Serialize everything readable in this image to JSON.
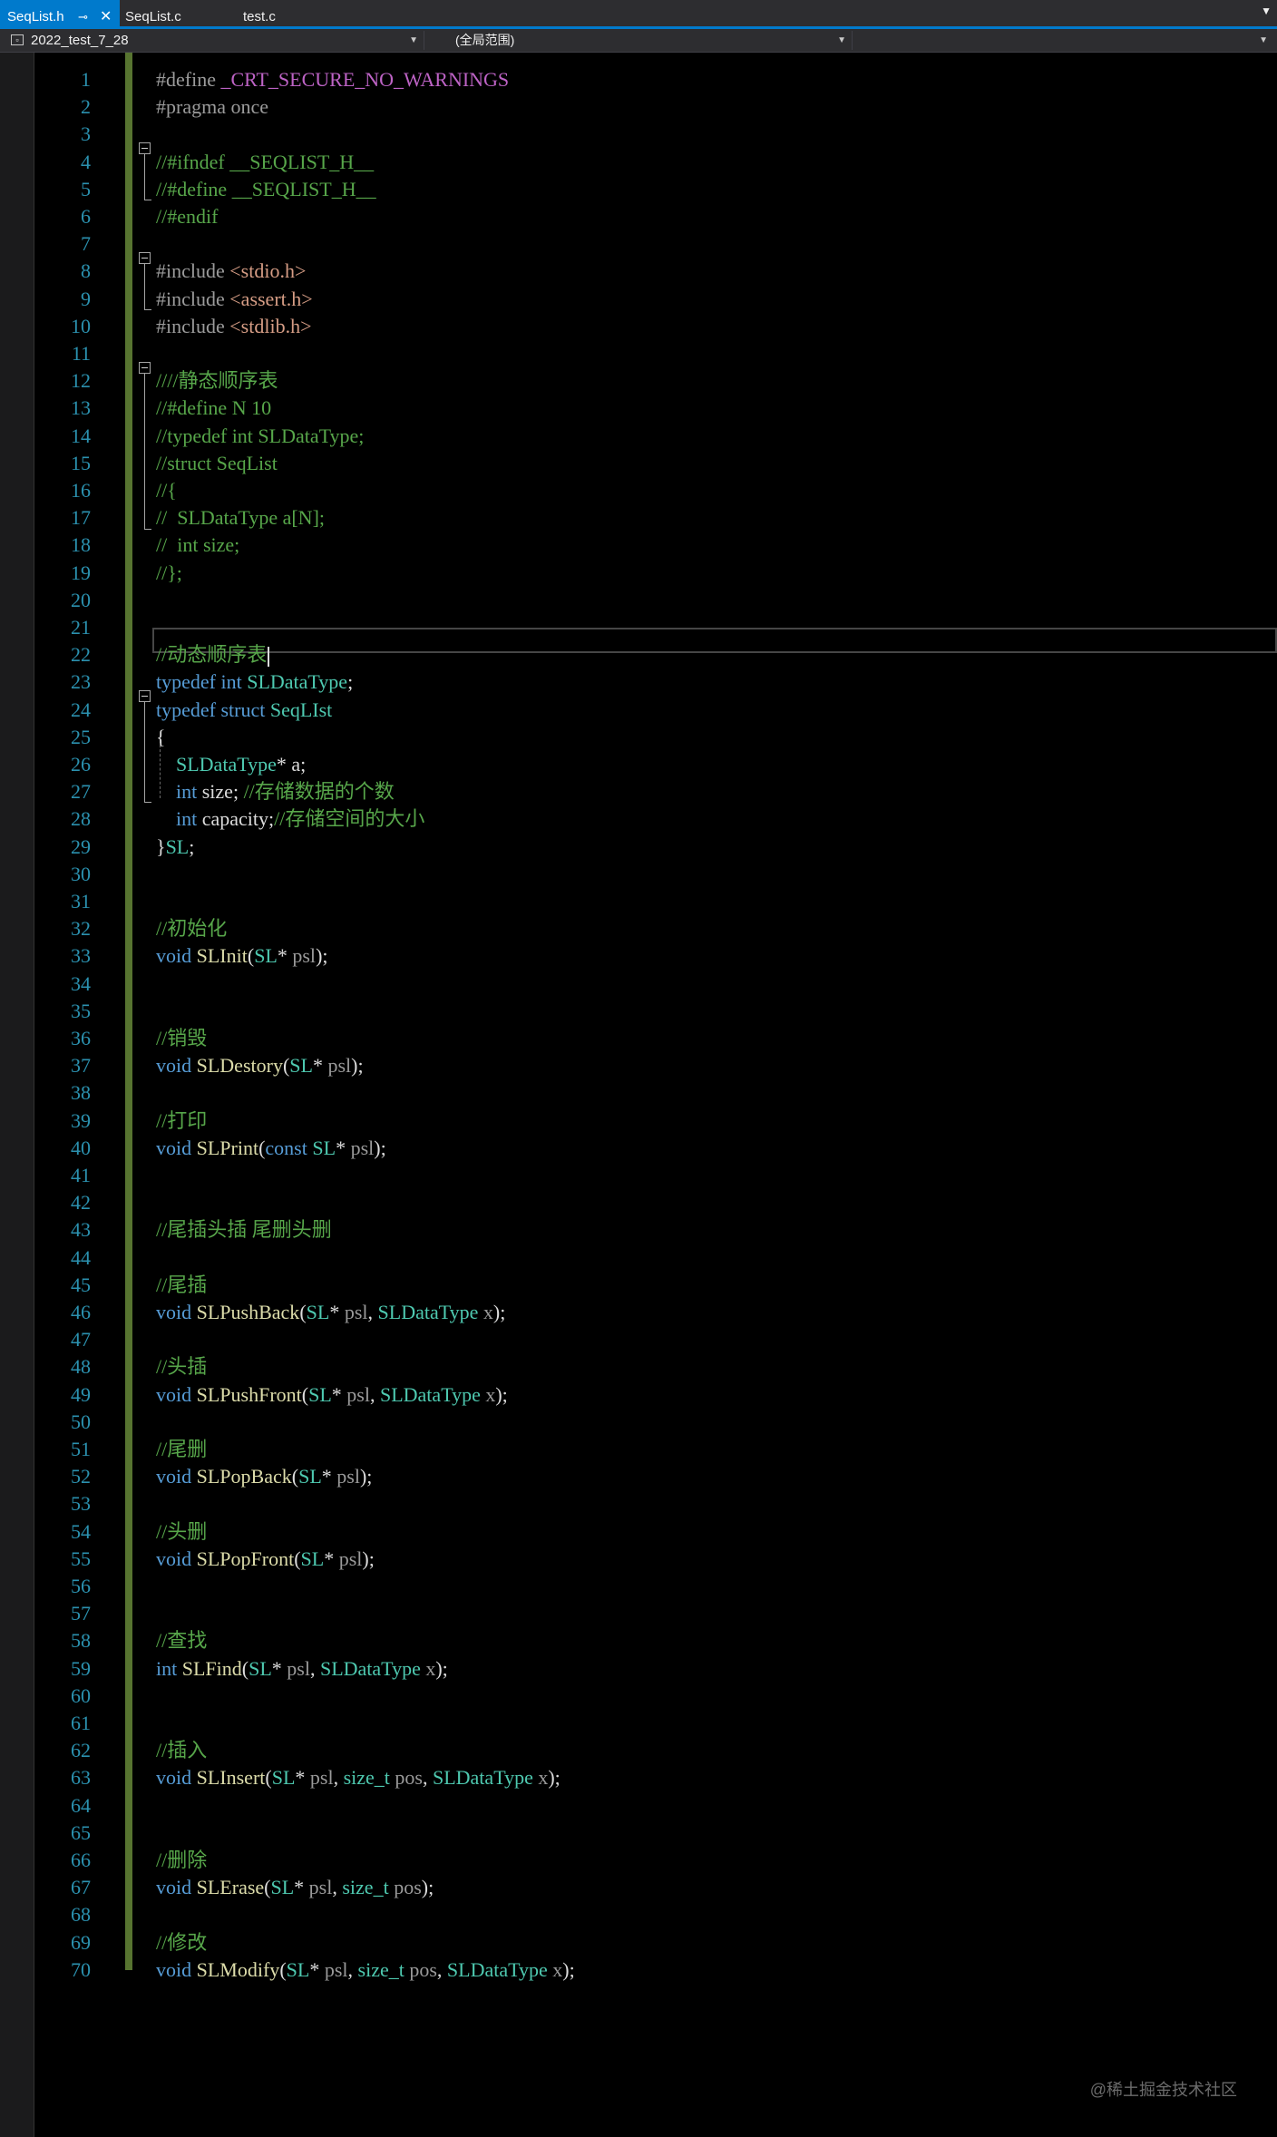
{
  "tabs": [
    {
      "label": "SeqList.h",
      "active": true
    },
    {
      "label": "SeqList.c",
      "active": false
    },
    {
      "label": "test.c",
      "active": false
    }
  ],
  "navbar": {
    "project": "2022_test_7_28",
    "scope": "(全局范围)",
    "member": ""
  },
  "colors": {
    "accent": "#007acc",
    "keyword": "#569cd6",
    "comment": "#57a64a",
    "type": "#4ec9b0",
    "function": "#dcdcaa",
    "macro": "#bd63c5",
    "string": "#d69d85",
    "preprocessor": "#9b9b9b",
    "line_number": "#2b91af",
    "change_bar": "#577430"
  },
  "editor": {
    "line_numbers": [
      "1",
      "2",
      "3",
      "4",
      "5",
      "6",
      "7",
      "8",
      "9",
      "10",
      "11",
      "12",
      "13",
      "14",
      "15",
      "16",
      "17",
      "18",
      "19",
      "20",
      "21",
      "22",
      "23",
      "24",
      "25",
      "26",
      "27",
      "28",
      "29",
      "30",
      "31",
      "32",
      "33",
      "34",
      "35",
      "36",
      "37",
      "38",
      "39",
      "40",
      "41",
      "42",
      "43",
      "44",
      "45",
      "46",
      "47",
      "48",
      "49",
      "50",
      "51",
      "52",
      "53",
      "54",
      "55",
      "56",
      "57",
      "58",
      "59",
      "60",
      "61",
      "62",
      "63",
      "64",
      "65",
      "66",
      "67",
      "68",
      "69",
      "70"
    ],
    "lines": [
      [
        [
          "pp",
          "#define "
        ],
        [
          "mc",
          "_CRT_SECURE_NO_WARNINGS"
        ]
      ],
      [
        [
          "pp",
          "#pragma once"
        ]
      ],
      [],
      [
        [
          "cm",
          "//#ifndef __SEQLIST_H__"
        ]
      ],
      [
        [
          "cm",
          "//#define __SEQLIST_H__"
        ]
      ],
      [
        [
          "cm",
          "//#endif"
        ]
      ],
      [],
      [
        [
          "pp",
          "#include "
        ],
        [
          "st",
          "<stdio.h>"
        ]
      ],
      [
        [
          "pp",
          "#include "
        ],
        [
          "st",
          "<assert.h>"
        ]
      ],
      [
        [
          "pp",
          "#include "
        ],
        [
          "st",
          "<stdlib.h>"
        ]
      ],
      [],
      [
        [
          "cm",
          "////静态顺序表"
        ]
      ],
      [
        [
          "cm",
          "//#define N 10"
        ]
      ],
      [
        [
          "cm",
          "//typedef int SLDataType;"
        ]
      ],
      [
        [
          "cm",
          "//struct SeqList"
        ]
      ],
      [
        [
          "cm",
          "//{"
        ]
      ],
      [
        [
          "cm",
          "//  SLDataType a[N];"
        ]
      ],
      [
        [
          "cm",
          "//  int size;"
        ]
      ],
      [
        [
          "cm",
          "//};"
        ]
      ],
      [],
      [],
      [
        [
          "cm",
          "//动态顺序表"
        ]
      ],
      [
        [
          "kw",
          "typedef "
        ],
        [
          "kw",
          "int "
        ],
        [
          "ty",
          "SLDataType"
        ],
        [
          "pl",
          ";"
        ]
      ],
      [
        [
          "kw",
          "typedef "
        ],
        [
          "kw",
          "struct "
        ],
        [
          "ty",
          "SeqLIst"
        ]
      ],
      [
        [
          "pl",
          "{"
        ]
      ],
      [
        [
          "pl",
          "    "
        ],
        [
          "ty",
          "SLDataType"
        ],
        [
          "pl",
          "* a;"
        ]
      ],
      [
        [
          "pl",
          "    "
        ],
        [
          "kw",
          "int "
        ],
        [
          "pl",
          "size; "
        ],
        [
          "cm",
          "//存储数据的个数"
        ]
      ],
      [
        [
          "pl",
          "    "
        ],
        [
          "kw",
          "int "
        ],
        [
          "pl",
          "capacity;"
        ],
        [
          "cm",
          "//存储空间的大小"
        ]
      ],
      [
        [
          "pl",
          "}"
        ],
        [
          "ty",
          "SL"
        ],
        [
          "pl",
          ";"
        ]
      ],
      [],
      [],
      [
        [
          "cm",
          "//初始化"
        ]
      ],
      [
        [
          "kw",
          "void "
        ],
        [
          "fn",
          "SLInit"
        ],
        [
          "pl",
          "("
        ],
        [
          "ty",
          "SL"
        ],
        [
          "pl",
          "* "
        ],
        [
          "pa",
          "psl"
        ],
        [
          "pl",
          ");"
        ]
      ],
      [],
      [],
      [
        [
          "cm",
          "//销毁"
        ]
      ],
      [
        [
          "kw",
          "void "
        ],
        [
          "fn",
          "SLDestory"
        ],
        [
          "pl",
          "("
        ],
        [
          "ty",
          "SL"
        ],
        [
          "pl",
          "* "
        ],
        [
          "pa",
          "psl"
        ],
        [
          "pl",
          ");"
        ]
      ],
      [],
      [
        [
          "cm",
          "//打印"
        ]
      ],
      [
        [
          "kw",
          "void "
        ],
        [
          "fn",
          "SLPrint"
        ],
        [
          "pl",
          "("
        ],
        [
          "kw",
          "const "
        ],
        [
          "ty",
          "SL"
        ],
        [
          "pl",
          "* "
        ],
        [
          "pa",
          "psl"
        ],
        [
          "pl",
          ");"
        ]
      ],
      [],
      [],
      [
        [
          "cm",
          "//尾插头插 尾删头删"
        ]
      ],
      [],
      [
        [
          "cm",
          "//尾插"
        ]
      ],
      [
        [
          "kw",
          "void "
        ],
        [
          "fn",
          "SLPushBack"
        ],
        [
          "pl",
          "("
        ],
        [
          "ty",
          "SL"
        ],
        [
          "pl",
          "* "
        ],
        [
          "pa",
          "psl"
        ],
        [
          "pl",
          ", "
        ],
        [
          "ty",
          "SLDataType "
        ],
        [
          "pa",
          "x"
        ],
        [
          "pl",
          ");"
        ]
      ],
      [],
      [
        [
          "cm",
          "//头插"
        ]
      ],
      [
        [
          "kw",
          "void "
        ],
        [
          "fn",
          "SLPushFront"
        ],
        [
          "pl",
          "("
        ],
        [
          "ty",
          "SL"
        ],
        [
          "pl",
          "* "
        ],
        [
          "pa",
          "psl"
        ],
        [
          "pl",
          ", "
        ],
        [
          "ty",
          "SLDataType "
        ],
        [
          "pa",
          "x"
        ],
        [
          "pl",
          ");"
        ]
      ],
      [],
      [
        [
          "cm",
          "//尾删"
        ]
      ],
      [
        [
          "kw",
          "void "
        ],
        [
          "fn",
          "SLPopBack"
        ],
        [
          "pl",
          "("
        ],
        [
          "ty",
          "SL"
        ],
        [
          "pl",
          "* "
        ],
        [
          "pa",
          "psl"
        ],
        [
          "pl",
          ");"
        ]
      ],
      [],
      [
        [
          "cm",
          "//头删"
        ]
      ],
      [
        [
          "kw",
          "void "
        ],
        [
          "fn",
          "SLPopFront"
        ],
        [
          "pl",
          "("
        ],
        [
          "ty",
          "SL"
        ],
        [
          "pl",
          "* "
        ],
        [
          "pa",
          "psl"
        ],
        [
          "pl",
          ");"
        ]
      ],
      [],
      [],
      [
        [
          "cm",
          "//查找"
        ]
      ],
      [
        [
          "kw",
          "int "
        ],
        [
          "fn",
          "SLFind"
        ],
        [
          "pl",
          "("
        ],
        [
          "ty",
          "SL"
        ],
        [
          "pl",
          "* "
        ],
        [
          "pa",
          "psl"
        ],
        [
          "pl",
          ", "
        ],
        [
          "ty",
          "SLDataType "
        ],
        [
          "pa",
          "x"
        ],
        [
          "pl",
          ");"
        ]
      ],
      [],
      [],
      [
        [
          "cm",
          "//插入"
        ]
      ],
      [
        [
          "kw",
          "void "
        ],
        [
          "fn",
          "SLInsert"
        ],
        [
          "pl",
          "("
        ],
        [
          "ty",
          "SL"
        ],
        [
          "pl",
          "* "
        ],
        [
          "pa",
          "psl"
        ],
        [
          "pl",
          ", "
        ],
        [
          "ty",
          "size_t "
        ],
        [
          "pa",
          "pos"
        ],
        [
          "pl",
          ", "
        ],
        [
          "ty",
          "SLDataType "
        ],
        [
          "pa",
          "x"
        ],
        [
          "pl",
          ");"
        ]
      ],
      [],
      [],
      [
        [
          "cm",
          "//删除"
        ]
      ],
      [
        [
          "kw",
          "void "
        ],
        [
          "fn",
          "SLErase"
        ],
        [
          "pl",
          "("
        ],
        [
          "ty",
          "SL"
        ],
        [
          "pl",
          "* "
        ],
        [
          "pa",
          "psl"
        ],
        [
          "pl",
          ", "
        ],
        [
          "ty",
          "size_t "
        ],
        [
          "pa",
          "pos"
        ],
        [
          "pl",
          ");"
        ]
      ],
      [],
      [
        [
          "cm",
          "//修改"
        ]
      ],
      [
        [
          "kw",
          "void "
        ],
        [
          "fn",
          "SLModify"
        ],
        [
          "pl",
          "("
        ],
        [
          "ty",
          "SL"
        ],
        [
          "pl",
          "* "
        ],
        [
          "pa",
          "psl"
        ],
        [
          "pl",
          ", "
        ],
        [
          "ty",
          "size_t "
        ],
        [
          "pa",
          "pos"
        ],
        [
          "pl",
          ", "
        ],
        [
          "ty",
          "SLDataType "
        ],
        [
          "pa",
          "x"
        ],
        [
          "pl",
          ");"
        ]
      ]
    ]
  },
  "watermark": "@稀土掘金技术社区"
}
